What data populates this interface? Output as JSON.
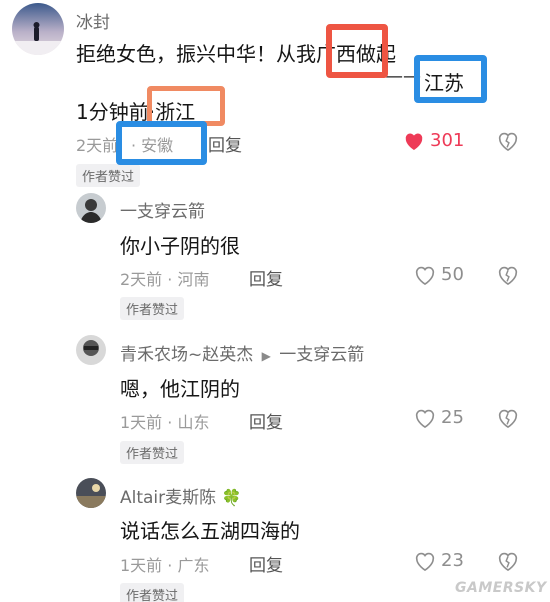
{
  "main_comment": {
    "username": "冰封",
    "text_line1": "拒绝女色，振兴中华！从我",
    "text_guangxi": "广西",
    "text_line1_end": "做起",
    "signature_dash": "——",
    "text_jiangsu": "江苏",
    "time": "1分钟前",
    "ip_prefix": "·",
    "ip_zhejiang": "浙江",
    "date": "2天前",
    "location": "· 安徽",
    "reply_label": "回复",
    "likes": "301",
    "author_badge": "作者赞过"
  },
  "replies": [
    {
      "username": "一支穿云箭",
      "text": "你小子阴的很",
      "meta": "2天前 · 河南",
      "reply_label": "回复",
      "likes": "50",
      "author_badge": "作者赞过"
    },
    {
      "username": "青禾农场~赵英杰",
      "reply_to": "一支穿云箭",
      "text": "嗯，他江阴的",
      "meta": "1天前 · 山东",
      "reply_label": "回复",
      "likes": "25",
      "author_badge": "作者赞过"
    },
    {
      "username": "Altair麦斯陈",
      "text": "说话怎么五湖四海的",
      "meta": "1天前 · 广东",
      "reply_label": "回复",
      "likes": "23",
      "author_badge": "作者赞过"
    }
  ],
  "watermark": "GAMERSKY",
  "colors": {
    "red_box": "#ee5543",
    "blue_box": "#2a8de3",
    "orange_box": "#f08a62",
    "like_active": "#ee3a57"
  },
  "icons": {
    "like": "heart-icon",
    "dislike": "broken-heart-icon",
    "clover": "clover-icon",
    "reply_arrow": "play-arrow-icon"
  }
}
